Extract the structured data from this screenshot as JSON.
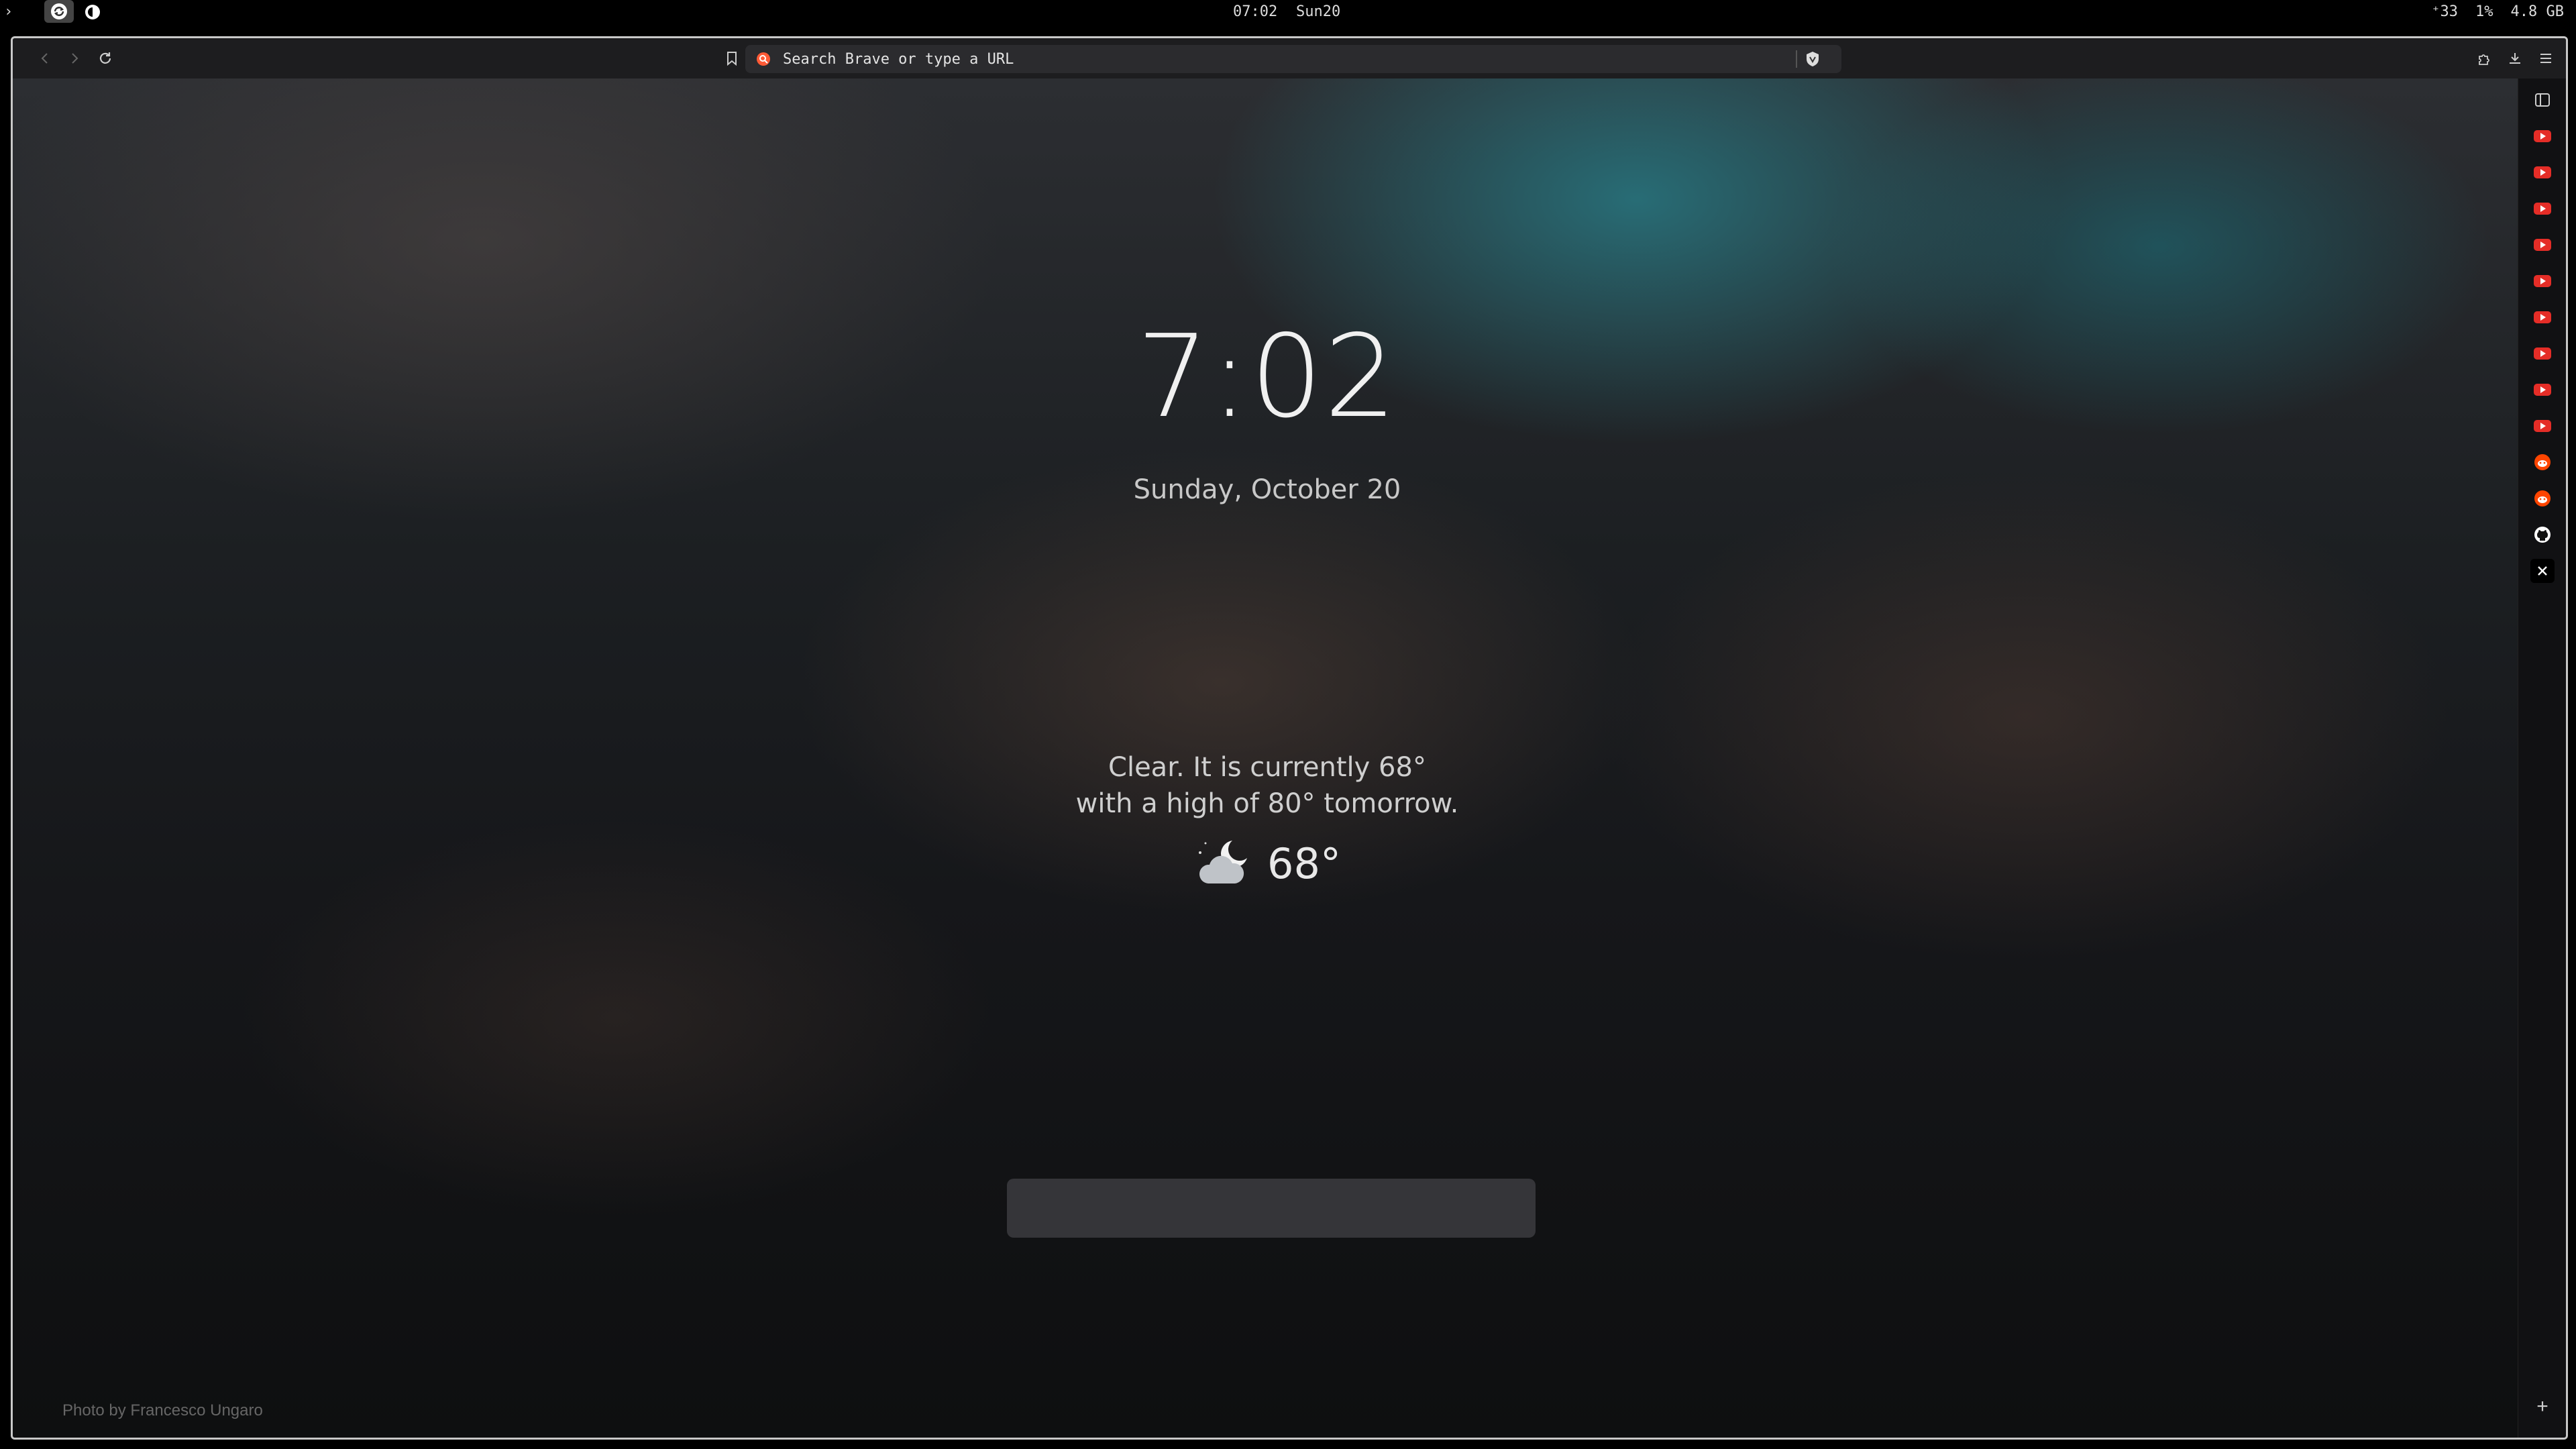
{
  "system_bar": {
    "arrow": "›",
    "time": "07:02",
    "day": "Sun20",
    "status_items": [
      "⁺33",
      "1%",
      "4.8 GB"
    ]
  },
  "browser": {
    "url_placeholder": "Search Brave or type a URL",
    "accent": "#e5412b"
  },
  "newtab": {
    "time": "7:02",
    "date": "Sunday, October 20",
    "weather_line1": "Clear. It is currently 68°",
    "weather_line2": "with a high of 80° tomorrow.",
    "temperature": "68°",
    "weather_icon": "moon-cloud-icon",
    "photo_credit": "Photo by Francesco Ungaro"
  },
  "sidebar": {
    "items": [
      {
        "icon": "youtube-icon"
      },
      {
        "icon": "youtube-icon"
      },
      {
        "icon": "youtube-icon"
      },
      {
        "icon": "youtube-icon"
      },
      {
        "icon": "youtube-icon"
      },
      {
        "icon": "youtube-icon"
      },
      {
        "icon": "youtube-icon"
      },
      {
        "icon": "youtube-icon"
      },
      {
        "icon": "youtube-icon"
      },
      {
        "icon": "reddit-icon"
      },
      {
        "icon": "reddit-icon"
      },
      {
        "icon": "github-icon"
      },
      {
        "icon": "x-icon"
      }
    ],
    "add_label": "+"
  }
}
